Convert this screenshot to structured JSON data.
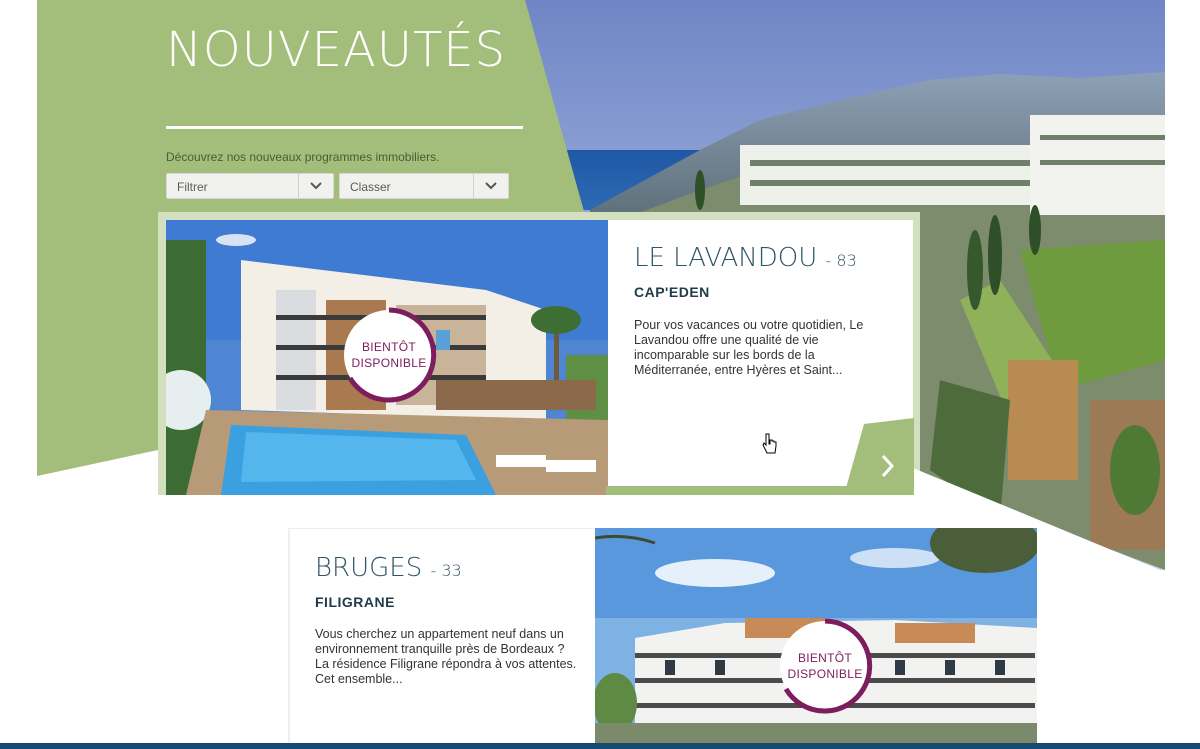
{
  "header": {
    "title": "NOUVEAUTÉS",
    "subtitle": "Découvrez nos nouveaux programmes immobiliers."
  },
  "filters": {
    "filter_label": "Filtrer",
    "sort_label": "Classer"
  },
  "programs": [
    {
      "city": "LE LAVANDOU",
      "dept": "- 83",
      "name": "CAP'EDEN",
      "description": "Pour vos vacances ou votre quotidien, Le Lavandou offre une qualité de vie incomparable sur les bords de la Méditerranée, entre Hyères et Saint...",
      "badge_line1": "BIENTÔT",
      "badge_line2": "DISPONIBLE"
    },
    {
      "city": "BRUGES",
      "dept": "- 33",
      "name": "FILIGRANE",
      "description": "Vous cherchez un appartement neuf dans un environnement tranquille près de Bordeaux ? La résidence Filigrane répondra à vos attentes. Cet ensemble...",
      "badge_line1": "BIENTÔT",
      "badge_line2": "DISPONIBLE"
    }
  ],
  "colors": {
    "green": "#a3be7b",
    "badge_accent": "#7d1d5d",
    "title_text": "#2e5566",
    "footer_bar": "#164a70"
  }
}
